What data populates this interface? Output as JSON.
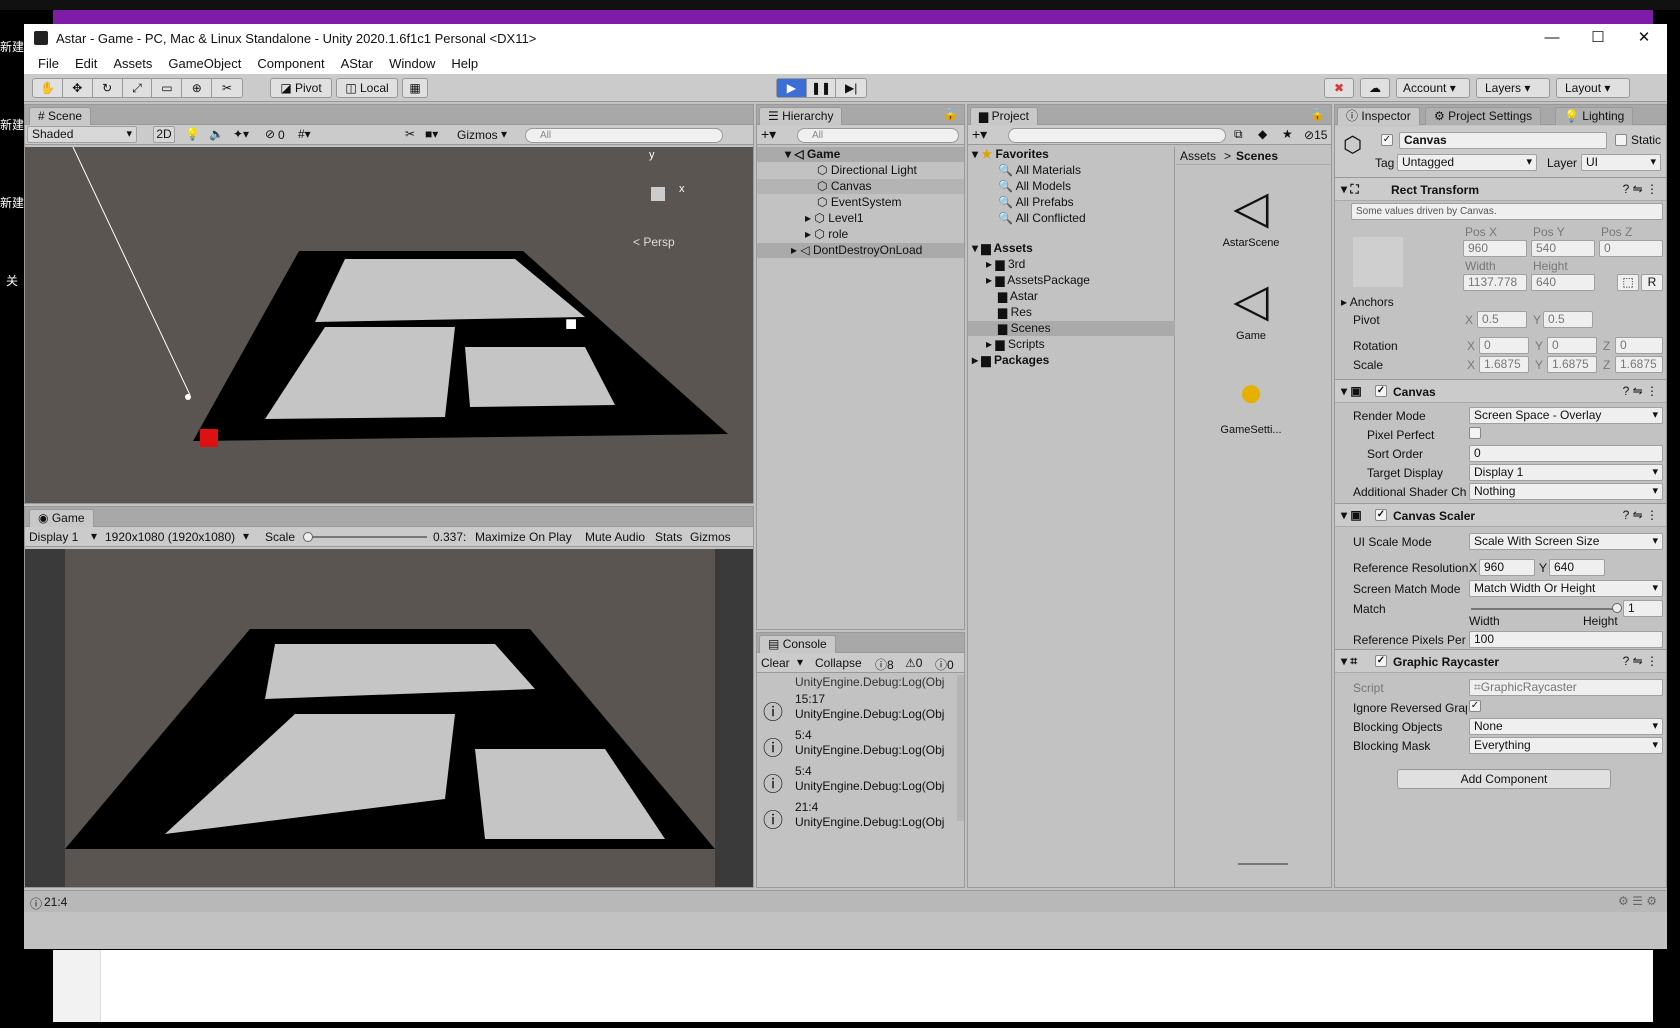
{
  "desktop": {
    "labels": [
      "新建",
      "新建",
      "新建",
      "关"
    ]
  },
  "window": {
    "title": "Astar - Game - PC, Mac & Linux Standalone - Unity 2020.1.6f1c1 Personal <DX11>",
    "controls": [
      "—",
      "☐",
      "✕"
    ]
  },
  "menu": [
    "File",
    "Edit",
    "Assets",
    "GameObject",
    "Component",
    "AStar",
    "Window",
    "Help"
  ],
  "toolbar": {
    "pivot": "Pivot",
    "local": "Local",
    "account": "Account",
    "layers": "Layers",
    "layout": "Layout"
  },
  "scene": {
    "tab": "Scene",
    "shading": "Shaded",
    "mode2d": "2D",
    "hidden_count": "0",
    "gizmos": "Gizmos",
    "search": "All",
    "persp": "Persp",
    "axis_y": "y",
    "axis_x": "x"
  },
  "game": {
    "tab": "Game",
    "display": "Display 1",
    "resolution": "1920x1080 (1920x1080)",
    "scale_label": "Scale",
    "scale_value": "0.337:",
    "maximize": "Maximize On Play",
    "mute": "Mute Audio",
    "stats": "Stats",
    "gizmos": "Gizmos"
  },
  "hierarchy": {
    "tab": "Hierarchy",
    "search": "All",
    "items": [
      {
        "label": "Game"
      },
      {
        "label": "Directional Light"
      },
      {
        "label": "Canvas"
      },
      {
        "label": "EventSystem"
      },
      {
        "label": "Level1"
      },
      {
        "label": "role"
      },
      {
        "label": "DontDestroyOnLoad"
      }
    ]
  },
  "project": {
    "tab": "Project",
    "badge": "15",
    "tree": [
      {
        "label": "Favorites"
      },
      {
        "label": "All Materials"
      },
      {
        "label": "All Models"
      },
      {
        "label": "All Prefabs"
      },
      {
        "label": "All Conflicted"
      },
      {
        "label": "Assets"
      },
      {
        "label": "3rd"
      },
      {
        "label": "AssetsPackage"
      },
      {
        "label": "Astar"
      },
      {
        "label": "Res"
      },
      {
        "label": "Scenes"
      },
      {
        "label": "Scripts"
      },
      {
        "label": "Packages"
      }
    ],
    "breadcrumb": [
      "Assets",
      ">",
      "Scenes"
    ],
    "assets": [
      "AstarScene",
      "Game",
      "GameSetti..."
    ]
  },
  "console": {
    "tab": "Console",
    "clear": "Clear",
    "collapse": "Collapse",
    "count_log": "8",
    "count_warn": "0",
    "count_err": "0",
    "top_line": "UnityEngine.Debug:Log(Obj",
    "entries": [
      {
        "time": "15:17",
        "msg": "UnityEngine.Debug:Log(Obj"
      },
      {
        "time": "5:4",
        "msg": "UnityEngine.Debug:Log(Obj"
      },
      {
        "time": "5:4",
        "msg": "UnityEngine.Debug:Log(Obj"
      },
      {
        "time": "21:4",
        "msg": "UnityEngine.Debug:Log(Obj"
      }
    ]
  },
  "inspector": {
    "tabs": [
      "Inspector",
      "Project Settings",
      "Lighting"
    ],
    "object_name": "Canvas",
    "static": "Static",
    "tag_label": "Tag",
    "tag": "Untagged",
    "layer_label": "Layer",
    "layer": "UI",
    "rect": {
      "title": "Rect Transform",
      "note": "Some values driven by Canvas.",
      "posx_l": "Pos X",
      "posy_l": "Pos Y",
      "posz_l": "Pos Z",
      "posx": "960",
      "posy": "540",
      "posz": "0",
      "w_l": "Width",
      "h_l": "Height",
      "w": "1137.778",
      "h": "640",
      "r": "R",
      "anchors": "Anchors",
      "pivot": "Pivot",
      "pivot_x": "0.5",
      "pivot_y": "0.5",
      "rotation": "Rotation",
      "rot_x": "0",
      "rot_y": "0",
      "rot_z": "0",
      "scale": "Scale",
      "scale_x": "1.6875",
      "scale_y": "1.6875",
      "scale_z": "1.6875",
      "X": "X",
      "Y": "Y",
      "Z": "Z"
    },
    "canvas": {
      "title": "Canvas",
      "render_mode_l": "Render Mode",
      "render_mode": "Screen Space - Overlay",
      "pixel_perfect_l": "Pixel Perfect",
      "sort_order_l": "Sort Order",
      "sort_order": "0",
      "target_display_l": "Target Display",
      "target_display": "Display 1",
      "shader_l": "Additional Shader Cha",
      "shader": "Nothing"
    },
    "scaler": {
      "title": "Canvas Scaler",
      "ui_scale_l": "UI Scale Mode",
      "ui_scale": "Scale With Screen Size",
      "ref_res_l": "Reference Resolution",
      "ref_x": "960",
      "ref_y": "640",
      "match_mode_l": "Screen Match Mode",
      "match_mode": "Match Width Or Height",
      "match_l": "Match",
      "match": "1",
      "match_value": 1,
      "width_l": "Width",
      "height_l": "Height",
      "ppu_l": "Reference Pixels Per U",
      "ppu": "100"
    },
    "raycaster": {
      "title": "Graphic Raycaster",
      "script_l": "Script",
      "script": "GraphicRaycaster",
      "ignore_l": "Ignore Reversed Grap",
      "blocking_l": "Blocking Objects",
      "blocking": "None",
      "mask_l": "Blocking Mask",
      "mask": "Everything"
    },
    "add_component": "Add Component"
  },
  "status": {
    "text": "21:4"
  }
}
